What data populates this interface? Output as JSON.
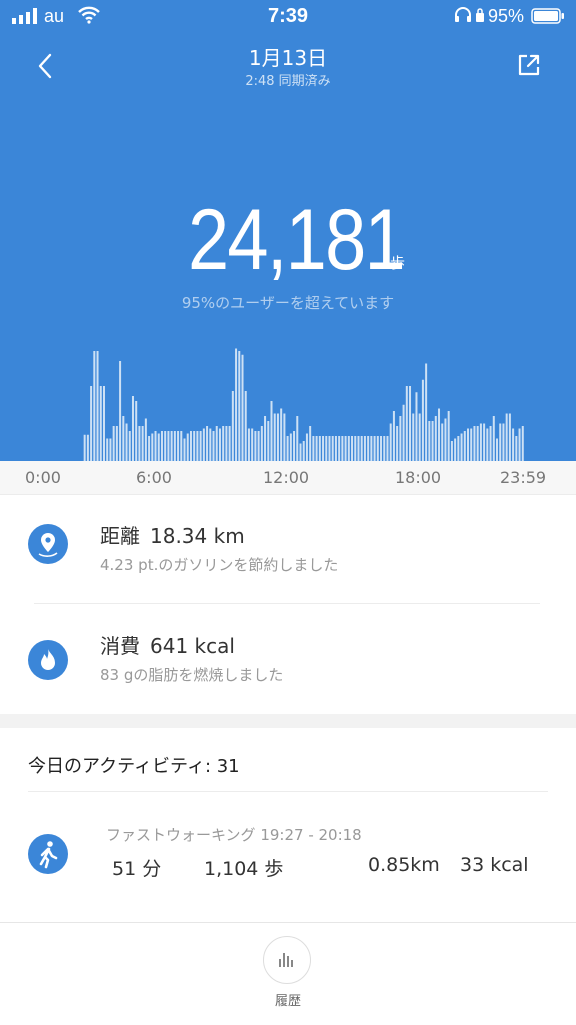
{
  "status_bar": {
    "carrier": "au",
    "time": "7:39",
    "battery": "95%"
  },
  "header": {
    "date": "1月13日",
    "sync": "2:48 同期済み"
  },
  "summary": {
    "steps": "24,181",
    "steps_unit": "歩",
    "rank": "95%のユーザーを超えています"
  },
  "chart_data": {
    "type": "bar",
    "x_ticks": [
      "0:00",
      "6:00",
      "12:00",
      "18:00",
      "23:59"
    ],
    "xlim": [
      0,
      24
    ],
    "bar_color": "#ffffff",
    "values": [
      0,
      0,
      0,
      0,
      0,
      0,
      0,
      0,
      0,
      0,
      0,
      0,
      21,
      21,
      60,
      88,
      88,
      60,
      60,
      18,
      18,
      28,
      28,
      80,
      36,
      30,
      24,
      52,
      48,
      28,
      28,
      34,
      20,
      22,
      24,
      22,
      24,
      24,
      24,
      24,
      24,
      24,
      24,
      18,
      22,
      24,
      24,
      24,
      24,
      26,
      28,
      26,
      24,
      28,
      26,
      28,
      28,
      28,
      56,
      90,
      88,
      85,
      56,
      26,
      26,
      24,
      24,
      28,
      36,
      32,
      48,
      38,
      38,
      42,
      38,
      20,
      22,
      24,
      36,
      14,
      16,
      22,
      28,
      20,
      20,
      20,
      20,
      20,
      20,
      20,
      20,
      20,
      20,
      20,
      20,
      20,
      20,
      20,
      20,
      20,
      20,
      20,
      20,
      20,
      20,
      20,
      20,
      30,
      40,
      28,
      36,
      45,
      60,
      60,
      38,
      55,
      38,
      65,
      78,
      32,
      32,
      36,
      42,
      30,
      34,
      40,
      16,
      18,
      20,
      22,
      24,
      26,
      26,
      28,
      28,
      30,
      30,
      26,
      28,
      36,
      18,
      30,
      30,
      38,
      38,
      26,
      20,
      26,
      28
    ]
  },
  "stats": {
    "distance": {
      "label": "距離",
      "value": "18.34 km",
      "sub": "4.23 pt.のガソリンを節約しました"
    },
    "calories": {
      "label": "消費",
      "value": "641 kcal",
      "sub": "83 gの脂肪を燃焼しました"
    }
  },
  "activity": {
    "title": "今日のアクティビティ: 31",
    "item": {
      "name": "ファストウォーキング 19:27 - 20:18",
      "duration": "51 分",
      "steps": "1,104 歩",
      "distance": "0.85km",
      "calories": "33 kcal"
    }
  },
  "bottom": {
    "history_label": "履歴"
  }
}
